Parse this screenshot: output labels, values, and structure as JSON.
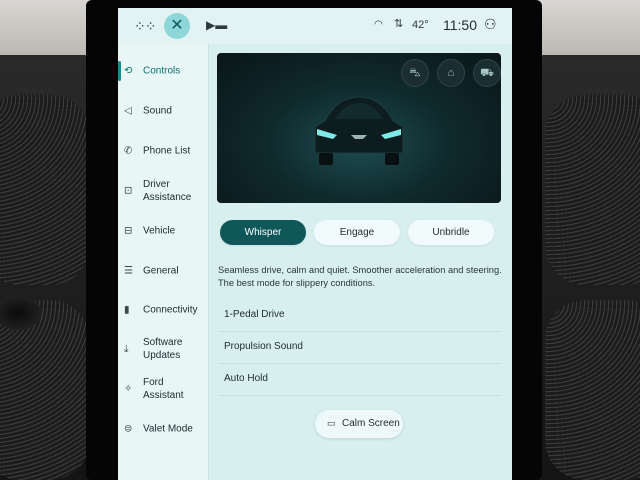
{
  "topbar": {
    "temperature": "42°",
    "time": "11:50"
  },
  "icons": {
    "apps": "grid-icon",
    "close": "close-icon",
    "media": "media-source-icon",
    "wifi": "wifi-icon",
    "signal": "signal-icon",
    "profile": "user-icon"
  },
  "sidebar": {
    "items": [
      {
        "label": "Controls",
        "icon": "controls-icon"
      },
      {
        "label": "Sound",
        "icon": "speaker-icon"
      },
      {
        "label": "Phone List",
        "icon": "phone-icon"
      },
      {
        "label": "Driver Assistance",
        "icon": "driver-assist-icon"
      },
      {
        "label": "Vehicle",
        "icon": "vehicle-icon"
      },
      {
        "label": "General",
        "icon": "sliders-icon"
      },
      {
        "label": "Connectivity",
        "icon": "connectivity-icon"
      },
      {
        "label": "Software Updates",
        "icon": "download-icon"
      },
      {
        "label": "Ford Assistant",
        "icon": "assistant-icon"
      },
      {
        "label": "Valet Mode",
        "icon": "valet-icon"
      }
    ],
    "active_index": 0
  },
  "drive_modes": {
    "options": [
      "Whisper",
      "Engage",
      "Unbridle"
    ],
    "selected": "Whisper",
    "description": "Seamless drive, calm and quiet. Smoother acceleration and steering. The best mode for slippery conditions."
  },
  "settings": [
    {
      "label": "1-Pedal Drive",
      "on": false
    },
    {
      "label": "Propulsion Sound",
      "on": true
    },
    {
      "label": "Auto Hold",
      "on": false
    }
  ],
  "calm_screen": {
    "label": "Calm Screen"
  },
  "colors": {
    "accent": "#10575a",
    "screen_bg": "#d7efef"
  }
}
